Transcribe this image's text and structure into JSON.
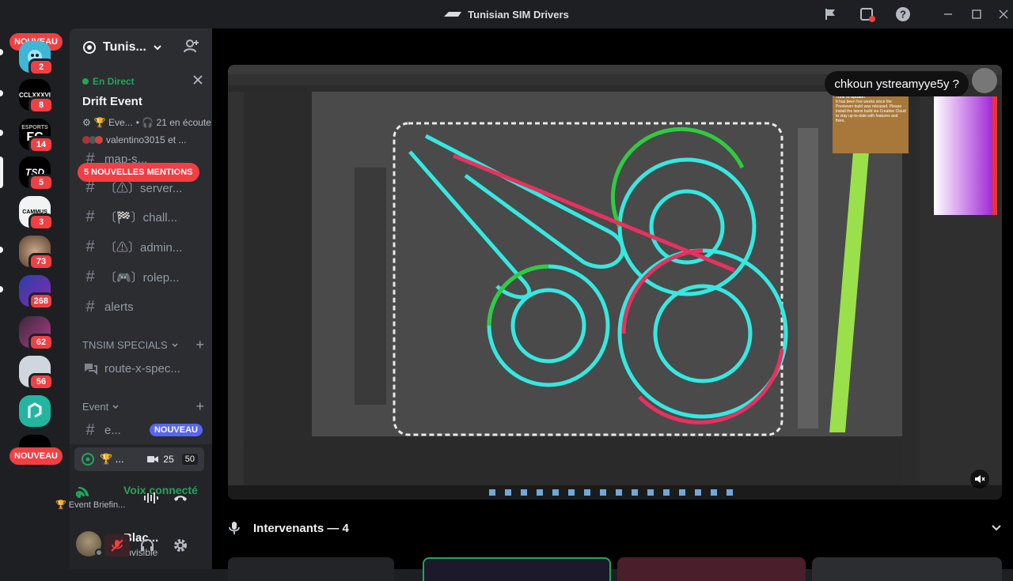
{
  "window": {
    "title": "Tunisian SIM Drivers"
  },
  "servers": [
    {
      "name": "server-1",
      "badge": "2",
      "color": "#3ba55c",
      "text": ""
    },
    {
      "name": "server-cclxxxvi",
      "badge": "8",
      "color": "#000000",
      "text": "CCLXXXVI"
    },
    {
      "name": "server-esports-fc",
      "badge": "14",
      "color": "#000000",
      "text": "FC"
    },
    {
      "name": "server-tsd",
      "badge": "5",
      "color": "#000000",
      "text": "TSD"
    },
    {
      "name": "server-cammus",
      "badge": "3",
      "color": "#f2f3f5",
      "text": "CAMMUS"
    },
    {
      "name": "server-6",
      "badge": "73",
      "color": "#7a5c4a",
      "text": ""
    },
    {
      "name": "server-7",
      "badge": "268",
      "color": "#5b2a8a",
      "text": ""
    },
    {
      "name": "server-8",
      "badge": "62",
      "color": "#6b3f6e",
      "text": ""
    },
    {
      "name": "server-9",
      "badge": "56",
      "color": "#cfd6dd",
      "text": ""
    },
    {
      "name": "server-10",
      "badge": "",
      "color": "#23b5a0",
      "text": ""
    }
  ],
  "rail": {
    "new_top": "NOUVEAU",
    "new_bottom": "NOUVEAU"
  },
  "guild": {
    "name": "Tunis...",
    "invite_icon": "add-user-icon"
  },
  "event": {
    "live_label": "En Direct",
    "title": "Drift Event",
    "meta": "🏆 Eve...",
    "listeners": "• 🎧 21 en écoute",
    "users": "valentino3015 et ..."
  },
  "mentions": "5 NOUVELLES MENTIONS",
  "channels": [
    {
      "name": "map-s...",
      "icon": "#"
    },
    {
      "name": "〔⚠〕server...",
      "icon": "#"
    },
    {
      "name": "〔🏁〕chall...",
      "icon": "#"
    },
    {
      "name": "〔⚠〕admin...",
      "icon": "#"
    },
    {
      "name": "〔🎮〕rolep...",
      "icon": "#"
    },
    {
      "name": "alerts",
      "icon": "#"
    }
  ],
  "category1": {
    "label": "TNSIM SPECIALS"
  },
  "forum_channel": {
    "name": "route-x-spec..."
  },
  "category2": {
    "label": "Event"
  },
  "event_channel": {
    "name": "e...",
    "tag": "NOUVEAU"
  },
  "stage_row": {
    "name": "🏆 ...",
    "video_count": "25",
    "limit": "50"
  },
  "voice": {
    "status": "Voix connecté",
    "channel": "🏆 Event Briefin..."
  },
  "user": {
    "name": "Blac...",
    "status": "Invisible"
  },
  "stream": {
    "bubble": "chkoun ystreamyye5y ?",
    "ps_notice_title": "Time to update!",
    "ps_notice_body": "It has been five weeks since the Previewer build was released. Please install the latest build via Creative Cloud to stay up-to-date with features and fixes."
  },
  "speakers": {
    "label": "Intervenants — 4"
  },
  "colors": {
    "accent": "#5865f2",
    "danger": "#f23f43",
    "online": "#23a55a",
    "track_cyan": "#35e8e0",
    "track_green": "#2ecc40",
    "track_red": "#e8315f"
  }
}
